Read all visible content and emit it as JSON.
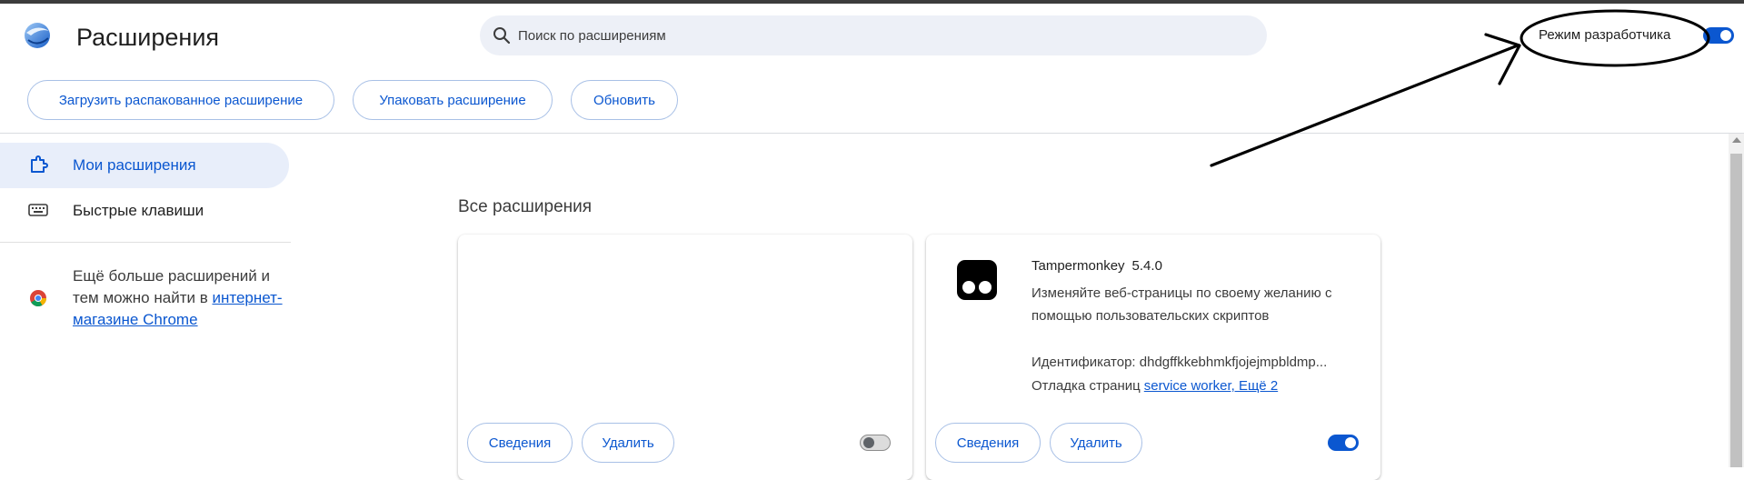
{
  "header": {
    "title": "Расширения",
    "search_placeholder": "Поиск по расширениям",
    "dev_mode_label": "Режим разработчика",
    "dev_mode_on": true
  },
  "toolbar": {
    "load_unpacked": "Загрузить распакованное расширение",
    "pack": "Упаковать расширение",
    "update": "Обновить"
  },
  "sidebar": {
    "items": [
      {
        "label": "Мои расширения",
        "icon": "puzzle-icon",
        "active": true
      },
      {
        "label": "Быстрые клавиши",
        "icon": "keyboard-icon",
        "active": false
      }
    ],
    "promo_text": "Ещё больше расширений и тем можно найти в",
    "promo_link": "интернет-магазине Chrome"
  },
  "main": {
    "section_title": "Все расширения",
    "cards": [
      {
        "name": "",
        "version": "",
        "enabled": false,
        "details_label": "Сведения",
        "remove_label": "Удалить"
      },
      {
        "name": "Tampermonkey",
        "version": "5.4.0",
        "description": "Изменяйте веб-страницы по своему желанию с помощью пользовательских скриптов",
        "id_text": "Идентификатор: dhdgffkkebhmkfjojejmpbldmp...",
        "debug_label": "Отладка страниц",
        "debug_link": "service worker, Ещё 2",
        "enabled": true,
        "details_label": "Сведения",
        "remove_label": "Удалить"
      }
    ]
  },
  "colors": {
    "accent": "#0b57d0",
    "active_bg": "#e8eefa",
    "search_bg": "#edf0f7"
  }
}
